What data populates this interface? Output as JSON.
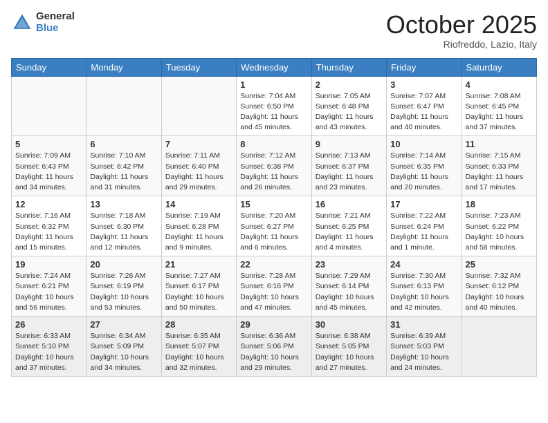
{
  "header": {
    "logo_general": "General",
    "logo_blue": "Blue",
    "month_title": "October 2025",
    "location": "Riofreddo, Lazio, Italy"
  },
  "weekdays": [
    "Sunday",
    "Monday",
    "Tuesday",
    "Wednesday",
    "Thursday",
    "Friday",
    "Saturday"
  ],
  "weeks": [
    [
      {
        "day": "",
        "info": ""
      },
      {
        "day": "",
        "info": ""
      },
      {
        "day": "",
        "info": ""
      },
      {
        "day": "1",
        "info": "Sunrise: 7:04 AM\nSunset: 6:50 PM\nDaylight: 11 hours\nand 45 minutes."
      },
      {
        "day": "2",
        "info": "Sunrise: 7:05 AM\nSunset: 6:48 PM\nDaylight: 11 hours\nand 43 minutes."
      },
      {
        "day": "3",
        "info": "Sunrise: 7:07 AM\nSunset: 6:47 PM\nDaylight: 11 hours\nand 40 minutes."
      },
      {
        "day": "4",
        "info": "Sunrise: 7:08 AM\nSunset: 6:45 PM\nDaylight: 11 hours\nand 37 minutes."
      }
    ],
    [
      {
        "day": "5",
        "info": "Sunrise: 7:09 AM\nSunset: 6:43 PM\nDaylight: 11 hours\nand 34 minutes."
      },
      {
        "day": "6",
        "info": "Sunrise: 7:10 AM\nSunset: 6:42 PM\nDaylight: 11 hours\nand 31 minutes."
      },
      {
        "day": "7",
        "info": "Sunrise: 7:11 AM\nSunset: 6:40 PM\nDaylight: 11 hours\nand 29 minutes."
      },
      {
        "day": "8",
        "info": "Sunrise: 7:12 AM\nSunset: 6:38 PM\nDaylight: 11 hours\nand 26 minutes."
      },
      {
        "day": "9",
        "info": "Sunrise: 7:13 AM\nSunset: 6:37 PM\nDaylight: 11 hours\nand 23 minutes."
      },
      {
        "day": "10",
        "info": "Sunrise: 7:14 AM\nSunset: 6:35 PM\nDaylight: 11 hours\nand 20 minutes."
      },
      {
        "day": "11",
        "info": "Sunrise: 7:15 AM\nSunset: 6:33 PM\nDaylight: 11 hours\nand 17 minutes."
      }
    ],
    [
      {
        "day": "12",
        "info": "Sunrise: 7:16 AM\nSunset: 6:32 PM\nDaylight: 11 hours\nand 15 minutes."
      },
      {
        "day": "13",
        "info": "Sunrise: 7:18 AM\nSunset: 6:30 PM\nDaylight: 11 hours\nand 12 minutes."
      },
      {
        "day": "14",
        "info": "Sunrise: 7:19 AM\nSunset: 6:28 PM\nDaylight: 11 hours\nand 9 minutes."
      },
      {
        "day": "15",
        "info": "Sunrise: 7:20 AM\nSunset: 6:27 PM\nDaylight: 11 hours\nand 6 minutes."
      },
      {
        "day": "16",
        "info": "Sunrise: 7:21 AM\nSunset: 6:25 PM\nDaylight: 11 hours\nand 4 minutes."
      },
      {
        "day": "17",
        "info": "Sunrise: 7:22 AM\nSunset: 6:24 PM\nDaylight: 11 hours\nand 1 minute."
      },
      {
        "day": "18",
        "info": "Sunrise: 7:23 AM\nSunset: 6:22 PM\nDaylight: 10 hours\nand 58 minutes."
      }
    ],
    [
      {
        "day": "19",
        "info": "Sunrise: 7:24 AM\nSunset: 6:21 PM\nDaylight: 10 hours\nand 56 minutes."
      },
      {
        "day": "20",
        "info": "Sunrise: 7:26 AM\nSunset: 6:19 PM\nDaylight: 10 hours\nand 53 minutes."
      },
      {
        "day": "21",
        "info": "Sunrise: 7:27 AM\nSunset: 6:17 PM\nDaylight: 10 hours\nand 50 minutes."
      },
      {
        "day": "22",
        "info": "Sunrise: 7:28 AM\nSunset: 6:16 PM\nDaylight: 10 hours\nand 47 minutes."
      },
      {
        "day": "23",
        "info": "Sunrise: 7:29 AM\nSunset: 6:14 PM\nDaylight: 10 hours\nand 45 minutes."
      },
      {
        "day": "24",
        "info": "Sunrise: 7:30 AM\nSunset: 6:13 PM\nDaylight: 10 hours\nand 42 minutes."
      },
      {
        "day": "25",
        "info": "Sunrise: 7:32 AM\nSunset: 6:12 PM\nDaylight: 10 hours\nand 40 minutes."
      }
    ],
    [
      {
        "day": "26",
        "info": "Sunrise: 6:33 AM\nSunset: 5:10 PM\nDaylight: 10 hours\nand 37 minutes."
      },
      {
        "day": "27",
        "info": "Sunrise: 6:34 AM\nSunset: 5:09 PM\nDaylight: 10 hours\nand 34 minutes."
      },
      {
        "day": "28",
        "info": "Sunrise: 6:35 AM\nSunset: 5:07 PM\nDaylight: 10 hours\nand 32 minutes."
      },
      {
        "day": "29",
        "info": "Sunrise: 6:36 AM\nSunset: 5:06 PM\nDaylight: 10 hours\nand 29 minutes."
      },
      {
        "day": "30",
        "info": "Sunrise: 6:38 AM\nSunset: 5:05 PM\nDaylight: 10 hours\nand 27 minutes."
      },
      {
        "day": "31",
        "info": "Sunrise: 6:39 AM\nSunset: 5:03 PM\nDaylight: 10 hours\nand 24 minutes."
      },
      {
        "day": "",
        "info": ""
      }
    ]
  ]
}
